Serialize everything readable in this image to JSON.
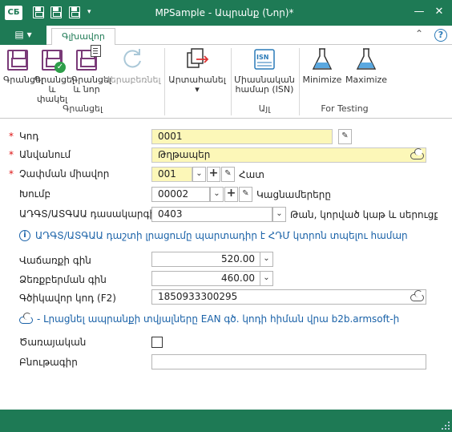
{
  "titlebar": {
    "logo": "СБ",
    "title": "MPSample - Ապրանք (Նոր)*",
    "minimize": "—",
    "close": "✕"
  },
  "tabs": {
    "file_icon": "▤",
    "file_arrow": "▾",
    "main": "Գլխավոր",
    "collapse": "⌃"
  },
  "help": "?",
  "ribbon": {
    "save": "Գրանցել",
    "save_close_1": "Գրանցել և",
    "save_close_2": "փակել",
    "save_new_1": "Գրանցել",
    "save_new_2": "և նոր",
    "refresh": "Վերաբեռնել",
    "group_save": "Գրանցել",
    "print": "Արտահանել",
    "print_arrow": "▾",
    "isn_1": "Միասնական",
    "isn_2": "համար (ISN)",
    "isn_badge": "ISN",
    "group_aj": "Այլ",
    "minimize": "Minimize",
    "maximize": "Maximize",
    "group_testing": "For Testing"
  },
  "form": {
    "code": {
      "label": "Կոդ",
      "value": "0001"
    },
    "name": {
      "label": "Անվանում",
      "value": "Թղթապեր"
    },
    "unit": {
      "label": "Չափման միավոր",
      "value": "001",
      "after": "Հատ"
    },
    "group": {
      "label": "Խումբ",
      "value": "00002",
      "after": "Կացնամերերը"
    },
    "adgs": {
      "label": "ԱԴԳՏ/ԱՏԳԱԱ դասակարգիչ",
      "value": "0403",
      "after": "Թան, կորված կաթ և սերուցք, յոգ"
    },
    "info_text": "ԱԴԳՏ/ԱՏԳԱԱ դաշտի լրացումը պարտադիր է ՀԴՄ կտրոն տպելու համար",
    "sale_price": {
      "label": "Վաճառքի գին",
      "value": "520.00"
    },
    "purchase_price": {
      "label": "Ձեռքբերման գին",
      "value": "460.00"
    },
    "barcode": {
      "label": "Գծիկավոր կոդ (F2)",
      "value": "1850933300295"
    },
    "cloud_text": "- Լրացնել ապրանքի տվյալները EAN գծ. կոդի հիման վրա b2b.armsoft-ի",
    "service": {
      "label": "Ծառայական"
    },
    "description": {
      "label": "Բնութագիր",
      "value": ""
    }
  },
  "colors": {
    "accent": "#1e7a55",
    "required": "#dd1111",
    "info": "#1a62a8",
    "highlight": "#fcf7b8"
  }
}
